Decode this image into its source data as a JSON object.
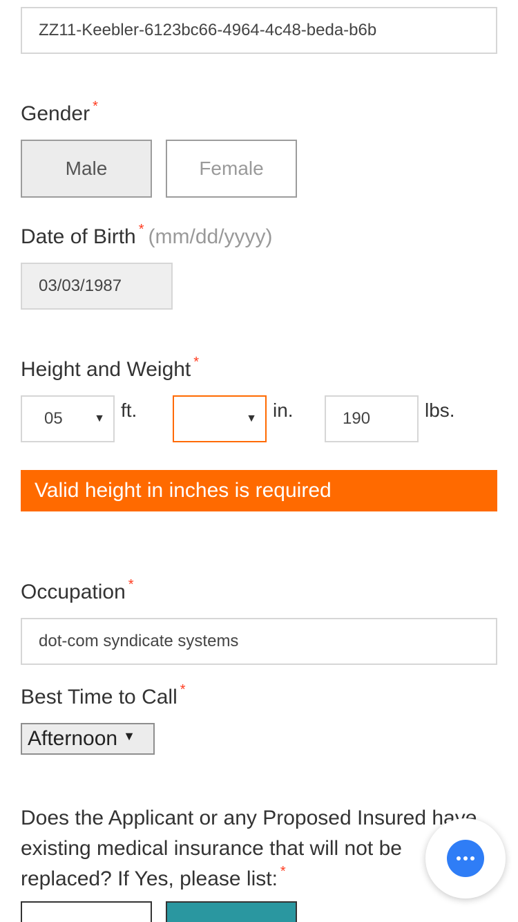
{
  "form": {
    "id_field": {
      "value": "ZZ11-Keebler-6123bc66-4964-4c48-beda-b6b"
    },
    "gender": {
      "label": "Gender",
      "required_mark": "*",
      "options": [
        "Male",
        "Female"
      ],
      "selected": "Male"
    },
    "dob": {
      "label": "Date of Birth",
      "required_mark": "*",
      "hint": "(mm/dd/yyyy)",
      "value": "03/03/1987"
    },
    "height_weight": {
      "label": "Height and Weight",
      "required_mark": "*",
      "feet": {
        "value": "05",
        "unit": "ft."
      },
      "inches": {
        "value": "",
        "unit": "in."
      },
      "weight": {
        "value": "190",
        "unit": "lbs."
      },
      "error": "Valid height in inches is required"
    },
    "occupation": {
      "label": "Occupation",
      "required_mark": "*",
      "value": "dot-com syndicate systems"
    },
    "best_time": {
      "label": "Best Time to Call",
      "required_mark": "*",
      "value": "Afternoon"
    },
    "medical_question": {
      "line1": "Does the Applicant or any Proposed Insured have",
      "line2": "existing medical insurance that will not be",
      "line3": "replaced? If Yes, please list:",
      "required_mark": "*"
    }
  },
  "colors": {
    "error": "#ff6a00",
    "required": "#ff3b1f",
    "teal": "#2a97a0",
    "chat": "#2f7df6"
  },
  "icons": {
    "dropdown": "▼",
    "chat": "chat-bubble-icon"
  }
}
